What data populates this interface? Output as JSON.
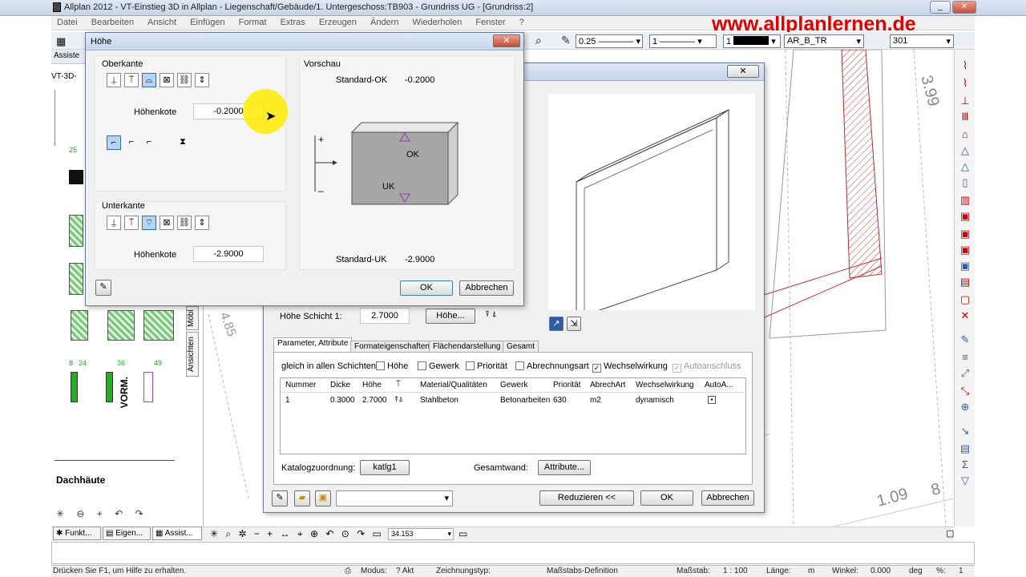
{
  "app": {
    "title": "Allplan 2012 - VT-Einstieg 3D in Allplan - Liegenschaft/Gebäude/1. Untergeschoss:TB903 - Grundriss UG - [Grundriss:2]",
    "brand_url": "www.allplanlernen.de",
    "menu": [
      "Datei",
      "Bearbeiten",
      "Ansicht",
      "Einfügen",
      "Format",
      "Extras",
      "Erzeugen",
      "Ändern",
      "Wiederholen",
      "Fenster",
      "?"
    ]
  },
  "toolbar": {
    "pen": "0.25",
    "line": "1",
    "color": "1",
    "layer": "AR_B_TR",
    "scale": "301"
  },
  "left_panel": {
    "tab_label": "Assiste",
    "title": "VT-3D-",
    "labels": [
      "Dachhäute",
      "VORM."
    ],
    "numbers": [
      "25",
      "8",
      "24",
      "36",
      "49"
    ],
    "bottom_tabs": [
      "Funkt...",
      "Eigen...",
      "Assist..."
    ],
    "side_tabs": [
      "Möbl",
      "Ansichten"
    ]
  },
  "drawing": {
    "dims": [
      "3.99",
      "1.09",
      "8",
      "4.85"
    ]
  },
  "dialog_hoehe": {
    "title": "Höhe",
    "oberkante_label": "Oberkante",
    "hoehenkote_label": "Höhenkote",
    "ok_value": "-0.2000",
    "unterkante_label": "Unterkante",
    "uk_value": "-2.9000",
    "vorschau_label": "Vorschau",
    "standard_ok_label": "Standard-OK",
    "standard_ok_value": "-0.2000",
    "standard_uk_label": "Standard-UK",
    "standard_uk_value": "-2.9000",
    "ok_marker": "OK",
    "uk_marker": "UK",
    "plus": "+",
    "minus": "–",
    "ok_button": "OK",
    "cancel_button": "Abbrechen"
  },
  "dialog_wand": {
    "hoehe_schicht_label": "Höhe Schicht 1:",
    "hoehe_schicht_value": "2.7000",
    "hoehe_button": "Höhe...",
    "tabs": [
      "Parameter, Attribute",
      "Formateigenschaften",
      "Flächendarstellung",
      "Gesamt"
    ],
    "gleich_label": "gleich in allen Schichten:",
    "checkboxes": [
      {
        "label": "Höhe",
        "checked": false
      },
      {
        "label": "Gewerk",
        "checked": false
      },
      {
        "label": "Priorität",
        "checked": false
      },
      {
        "label": "Abrechnungsart",
        "checked": false
      },
      {
        "label": "Wechselwirkung",
        "checked": true
      },
      {
        "label": "Autoanschluss",
        "checked": true
      }
    ],
    "table": {
      "headers": [
        "Nummer",
        "Dicke",
        "Höhe",
        "",
        "Material/Qualitäten",
        "Gewerk",
        "Priorität",
        "AbrechArt",
        "Wechselwirkung",
        "AutoA..."
      ],
      "rows": [
        [
          "1",
          "0.3000",
          "2.7000",
          "",
          "Stahlbeton",
          "Betonarbeiten",
          "630",
          "m2",
          "dynamisch",
          ""
        ]
      ]
    },
    "katalog_label": "Katalogzuordnung:",
    "katalog_button": "katlg1",
    "gesamtwand_label": "Gesamtwand:",
    "attribute_button": "Attribute...",
    "reduzieren_button": "Reduzieren <<",
    "ok_button": "OK",
    "cancel_button": "Abbrechen"
  },
  "navbar": {
    "zoom_value": "34.153"
  },
  "status": {
    "help": "Drücken Sie F1, um Hilfe zu erhalten.",
    "modus": "Modus:",
    "modus_value": "? Akt",
    "zeichnungstyp": "Zeichnungstyp:",
    "massstabs": "Maßstabs-Definition",
    "massstab": "Maßstab:",
    "massstab_value": "1 : 100",
    "laenge": "Länge:",
    "laenge_value": "m",
    "winkel": "Winkel:",
    "winkel_value": "0.000",
    "deg": "deg",
    "percent": "%:",
    "percent_value": "1"
  }
}
